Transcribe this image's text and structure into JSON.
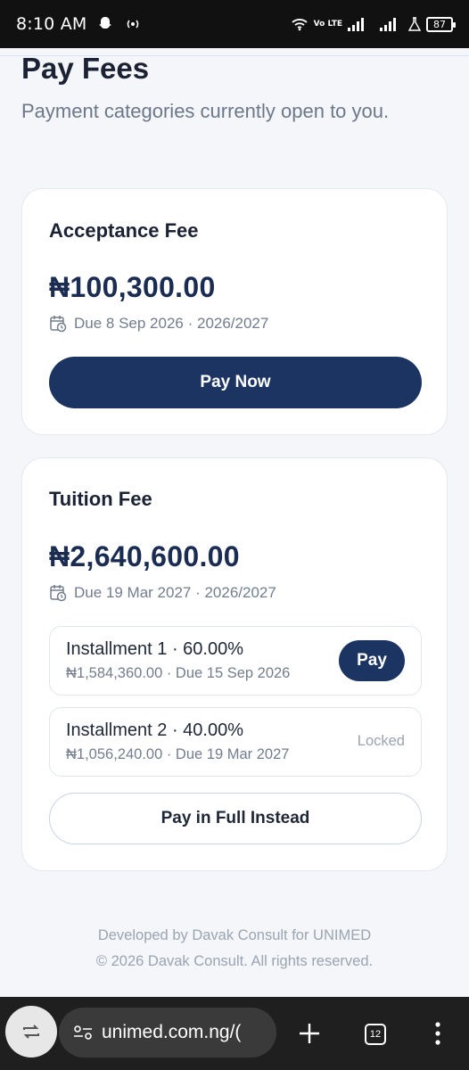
{
  "status_bar": {
    "time": "8:10 AM",
    "network": "Vo LTE",
    "battery": "87"
  },
  "page": {
    "title": "Pay Fees",
    "subtitle": "Payment categories currently open to you."
  },
  "acceptance_fee": {
    "title": "Acceptance Fee",
    "amount": "₦100,300.00",
    "due": "Due 8 Sep 2026 · 2026/2027",
    "pay_label": "Pay Now"
  },
  "tuition_fee": {
    "title": "Tuition Fee",
    "amount": "₦2,640,600.00",
    "due": "Due 19 Mar 2027 · 2026/2027",
    "installments": [
      {
        "title": "Installment 1 · 60.00%",
        "detail": "₦1,584,360.00 · Due 15 Sep 2026",
        "action": "Pay"
      },
      {
        "title": "Installment 2 · 40.00%",
        "detail": "₦1,056,240.00 · Due 19 Mar 2027",
        "status": "Locked"
      }
    ],
    "full_label": "Pay in Full Instead"
  },
  "footer": {
    "line1": "Developed by Davak Consult for UNIMED",
    "line2": "© 2026 Davak Consult. All rights reserved."
  },
  "browser": {
    "url": "unimed.com.ng/(",
    "tab_count": "12"
  },
  "colors": {
    "primary": "#1b3461",
    "amount": "#1b2c52",
    "background": "#f4f6fa"
  }
}
